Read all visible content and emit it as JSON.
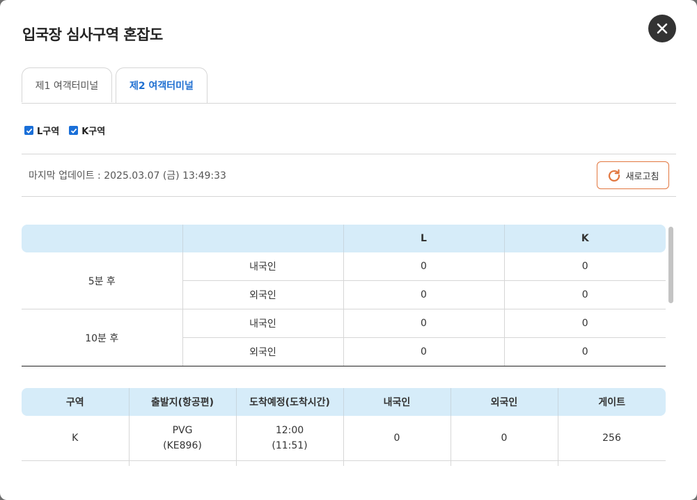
{
  "modal": {
    "title": "입국장 심사구역 혼잡도"
  },
  "tabs": [
    {
      "label": "제1 여객터미널",
      "active": false
    },
    {
      "label": "제2 여객터미널",
      "active": true
    }
  ],
  "filters": [
    {
      "label": "L구역",
      "checked": true
    },
    {
      "label": "K구역",
      "checked": true
    }
  ],
  "last_updated": "마지막 업데이트 : 2025.03.07 (금) 13:49:33",
  "refresh_label": "새로고침",
  "congestion_table": {
    "headers": [
      "",
      "",
      "L",
      "K"
    ],
    "groups": [
      {
        "label": "5분 후",
        "rows": [
          {
            "type": "내국인",
            "L": "0",
            "K": "0"
          },
          {
            "type": "외국인",
            "L": "0",
            "K": "0"
          }
        ]
      },
      {
        "label": "10분 후",
        "rows": [
          {
            "type": "내국인",
            "L": "0",
            "K": "0"
          },
          {
            "type": "외국인",
            "L": "0",
            "K": "0"
          }
        ]
      }
    ]
  },
  "flight_table": {
    "headers": [
      "구역",
      "출발지(항공편)",
      "도착예정(도착시간)",
      "내국인",
      "외국인",
      "게이트"
    ],
    "rows": [
      {
        "zone": "K",
        "origin": "PVG",
        "flight": "(KE896)",
        "eta": "12:00",
        "arrival": "(11:51)",
        "domestic": "0",
        "foreign": "0",
        "gate": "256"
      }
    ]
  },
  "colors": {
    "accent_blue": "#1f6fd1",
    "header_bg": "#d6ecf9",
    "refresh_border": "#e2773f",
    "close_bg": "#333333"
  }
}
